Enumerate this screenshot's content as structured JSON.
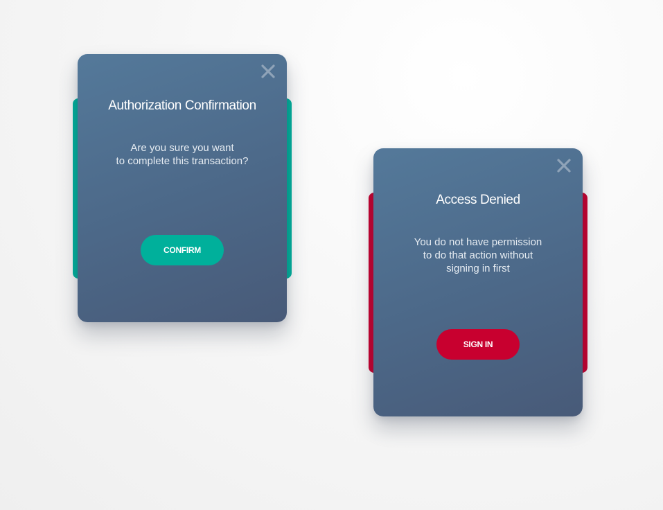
{
  "modals": {
    "confirm": {
      "title": "Authorization Confirmation",
      "message_lines": [
        "Are you sure you want",
        "to complete this transaction?"
      ],
      "button_label": "CONFIRM",
      "accent_color": "#00b09b",
      "close_icon": "close-icon"
    },
    "denied": {
      "title": "Access Denied",
      "message_lines": [
        "You do not have permission",
        "to do that action without",
        "signing in first"
      ],
      "button_label": "SIGN IN",
      "accent_color": "#c8002f",
      "close_icon": "close-icon"
    }
  },
  "colors": {
    "card_gradient_top": "#54799a",
    "card_gradient_bottom": "#485a78",
    "close_icon": "#8fa3b8"
  }
}
